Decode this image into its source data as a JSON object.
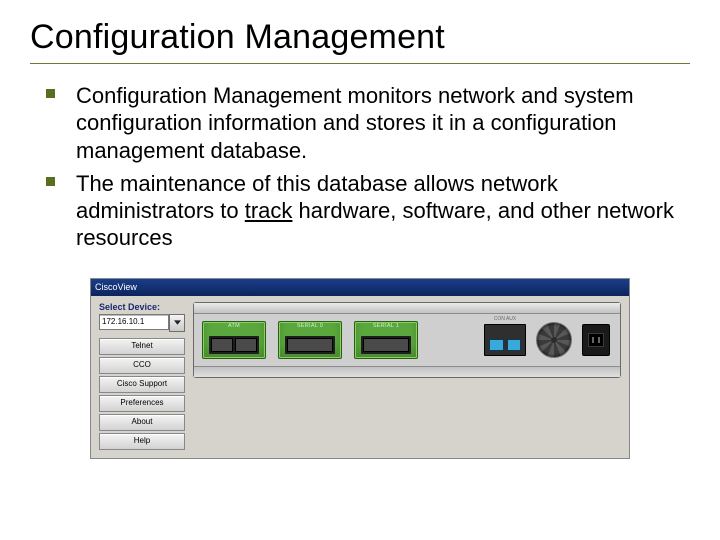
{
  "title": "Configuration Management",
  "bullets": [
    {
      "text": "Configuration Management monitors network and system configuration information and stores it in a configuration management database."
    },
    {
      "pre": "The maintenance of this database allows network administrators to ",
      "underlined": "track",
      "post": " hardware, software, and other network resources"
    }
  ],
  "device": {
    "window_title": "CiscoView",
    "side": {
      "label": "Select Device:",
      "value": "172.16.10.1",
      "buttons": [
        "Telnet",
        "CCO",
        "Cisco Support",
        "Preferences",
        "About",
        "Help"
      ]
    },
    "modules": [
      {
        "label": "ATM"
      },
      {
        "label": "SERIAL 0"
      },
      {
        "label": "SERIAL 1"
      }
    ],
    "con_label": "CON   AUX"
  }
}
